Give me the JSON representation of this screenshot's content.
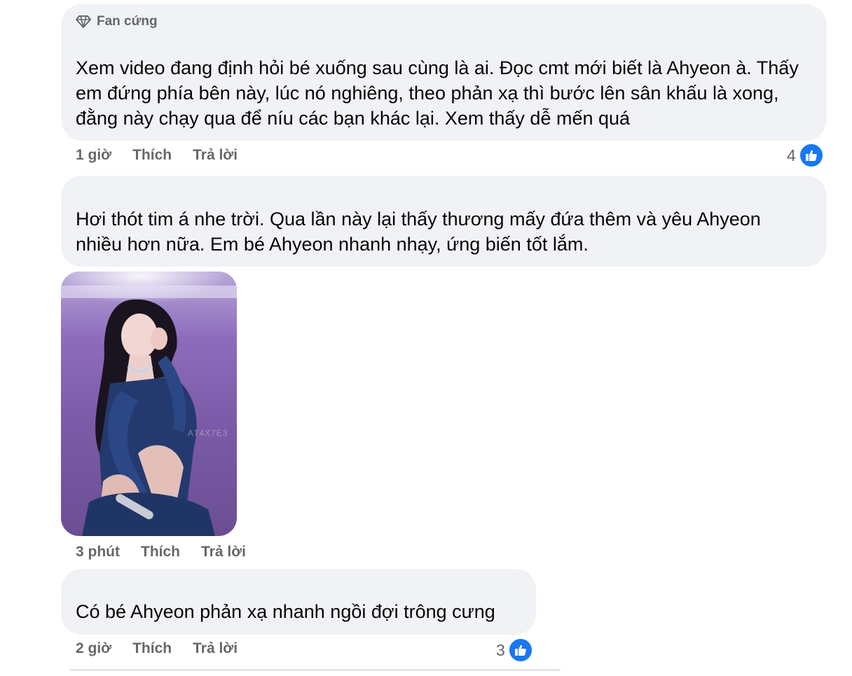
{
  "comments": [
    {
      "badge": "Fan cứng",
      "text": "Xem video đang định hỏi bé xuống sau cùng là ai. Đọc cmt mới biết là Ahyeon à. Thấy\nem đứng phía bên này, lúc nó nghiêng, theo phản xạ thì bước lên sân khấu là xong,\nđằng này chạy qua để níu các bạn khác lại. Xem thấy dễ mến quá",
      "time": "1 giờ",
      "like_label": "Thích",
      "reply_label": "Trả lời",
      "reaction_count": "4",
      "reaction_icon": "like-icon"
    },
    {
      "text": "Hơi thót tim á nhe trời. Qua lần này lại thấy thương mấy đứa thêm và yêu Ahyeon\nnhiều hơn nữa. Em bé Ahyeon nhanh nhạy, ứng biến tốt lắm.",
      "photo_watermark": "AT4X7E3",
      "time": "3 phút",
      "like_label": "Thích",
      "reply_label": "Trả lời"
    },
    {
      "text": "Có bé Ahyeon phản xạ nhanh ngồi đợi trông cưng",
      "time": "2 giờ",
      "like_label": "Thích",
      "reply_label": "Trả lời",
      "reaction_count": "3",
      "reaction_icon": "like-icon"
    }
  ],
  "colors": {
    "bubble_bg": "#f0f2f5",
    "meta_text": "#65676b",
    "like_blue": "#1877f2",
    "photo_bg": "#7a5ca8"
  }
}
